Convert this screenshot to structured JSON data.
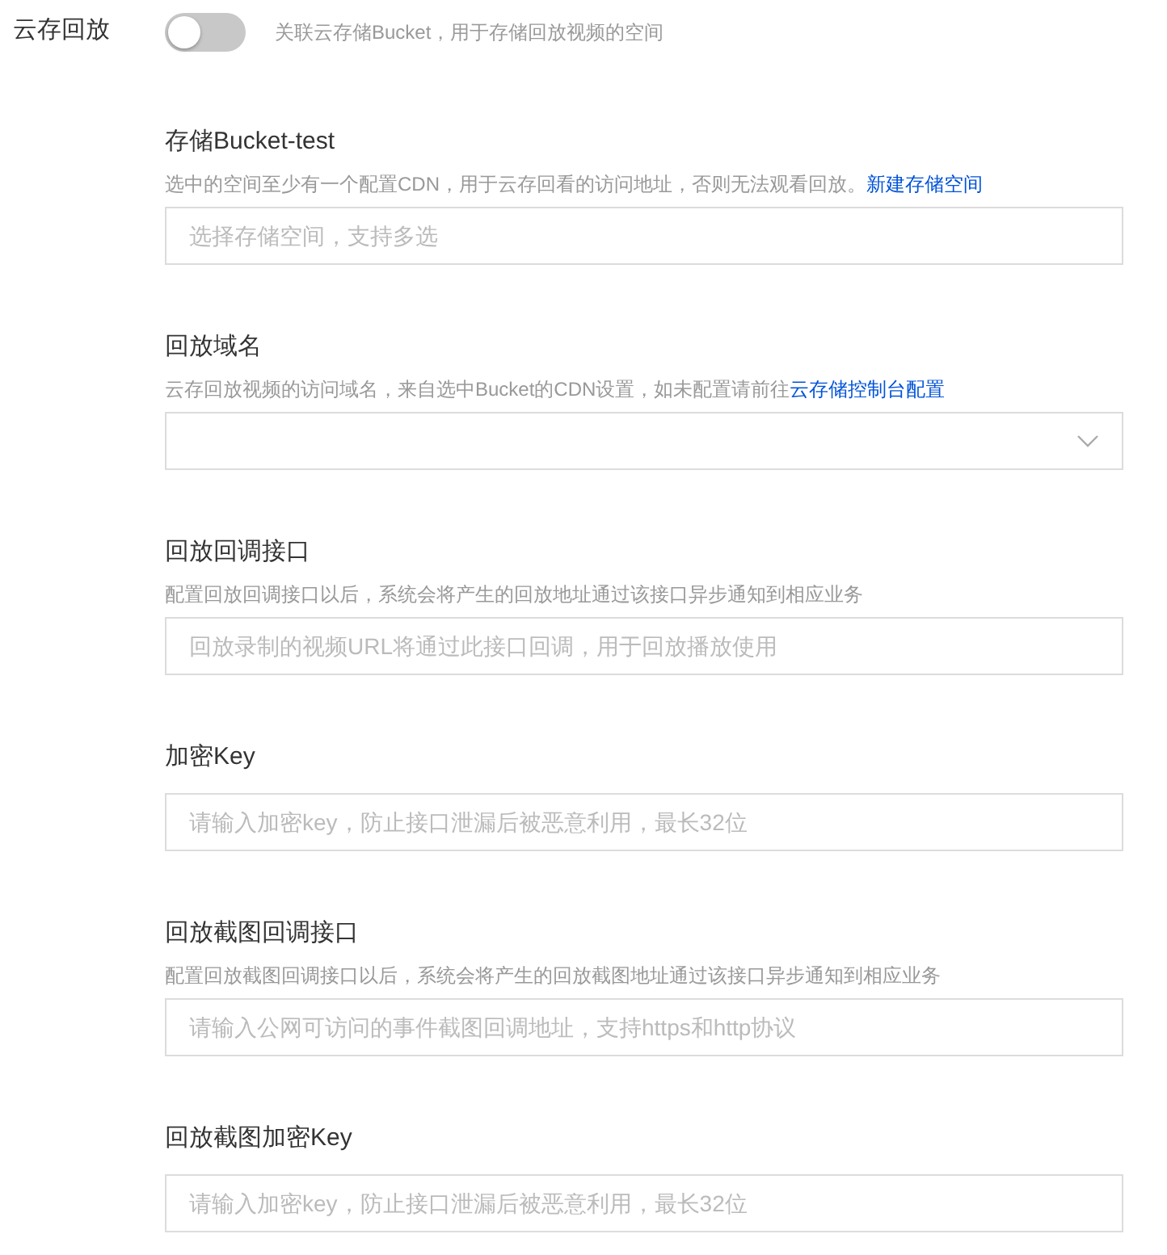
{
  "header": {
    "label": "云存回放",
    "toggle": {
      "on": false
    },
    "hint": "关联云存储Bucket，用于存储回放视频的空间"
  },
  "fields": [
    {
      "kind": "input",
      "title": "存储Bucket-test",
      "hint": "选中的空间至少有一个配置CDN，用于云存回看的访问地址，否则无法观看回放。",
      "hint_link": "新建存储空间",
      "placeholder": "选择存储空间，支持多选"
    },
    {
      "kind": "select",
      "title": "回放域名",
      "hint": "云存回放视频的访问域名，来自选中Bucket的CDN设置，如未配置请前往",
      "hint_link": "云存储控制台配置"
    },
    {
      "kind": "input",
      "title": "回放回调接口",
      "hint": "配置回放回调接口以后，系统会将产生的回放地址通过该接口异步通知到相应业务",
      "placeholder": "回放录制的视频URL将通过此接口回调，用于回放播放使用"
    },
    {
      "kind": "input",
      "title": "加密Key",
      "placeholder": "请输入加密key，防止接口泄漏后被恶意利用，最长32位"
    },
    {
      "kind": "input",
      "title": "回放截图回调接口",
      "hint": "配置回放截图回调接口以后，系统会将产生的回放截图地址通过该接口异步通知到相应业务",
      "placeholder": "请输入公网可访问的事件截图回调地址，支持https和http协议"
    },
    {
      "kind": "input",
      "title": "回放截图加密Key",
      "placeholder": "请输入加密key，防止接口泄漏后被恶意利用，最长32位"
    }
  ]
}
